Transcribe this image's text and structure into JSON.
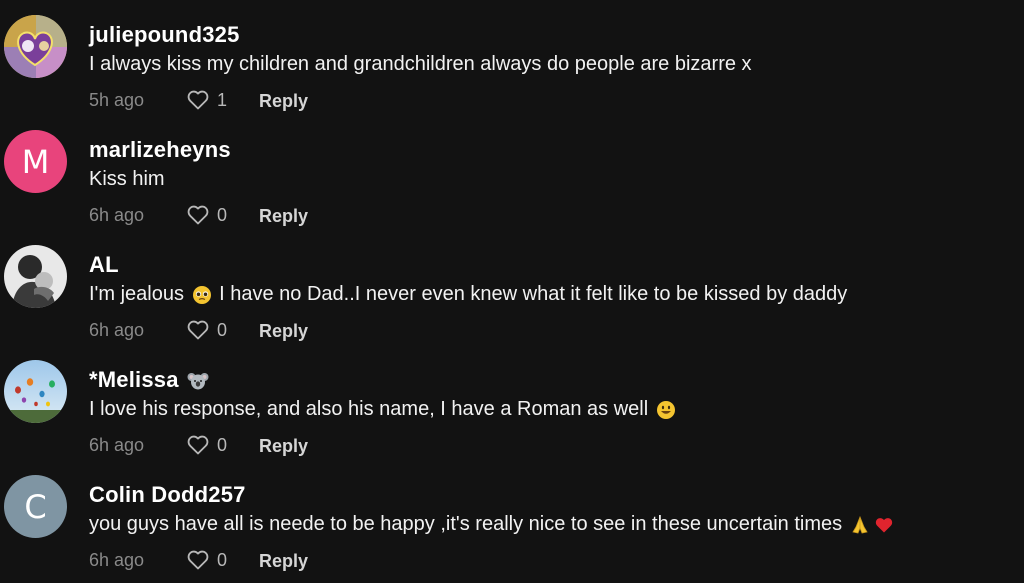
{
  "comments": [
    {
      "username": "juliepound325",
      "text": "I always kiss my children and grandchildren always do people are bizarre x",
      "time": "5h ago",
      "likes": "1",
      "reply_label": "Reply",
      "avatar": {
        "type": "image",
        "icon": "collage-photo"
      }
    },
    {
      "username": "marlizeheyns",
      "text": "Kiss him",
      "time": "6h ago",
      "likes": "0",
      "reply_label": "Reply",
      "avatar": {
        "type": "letter",
        "letter": "M",
        "color": "#e8447c"
      }
    },
    {
      "username": "AL",
      "text_before": "I'm jealous",
      "text_after": "I have no Dad..I never even knew what it felt like to be kissed by daddy",
      "time": "6h ago",
      "likes": "0",
      "reply_label": "Reply",
      "avatar": {
        "type": "image",
        "icon": "grayscale-portrait"
      }
    },
    {
      "username": "*Melissa",
      "text": "I love his response, and also his name, I have a Roman as well",
      "time": "6h ago",
      "likes": "0",
      "reply_label": "Reply",
      "avatar": {
        "type": "image",
        "icon": "sky-balloons"
      }
    },
    {
      "username": "Colin Dodd257",
      "text": "you guys have all is neede to be happy ,it's really nice to see in these uncertain times",
      "time": "6h ago",
      "likes": "0",
      "reply_label": "Reply",
      "avatar": {
        "type": "letter",
        "letter": "C",
        "color": "#7f95a3"
      }
    }
  ],
  "colors": {
    "background": "#121212",
    "username": "#ffffff",
    "meta": "#8a8a8a"
  }
}
